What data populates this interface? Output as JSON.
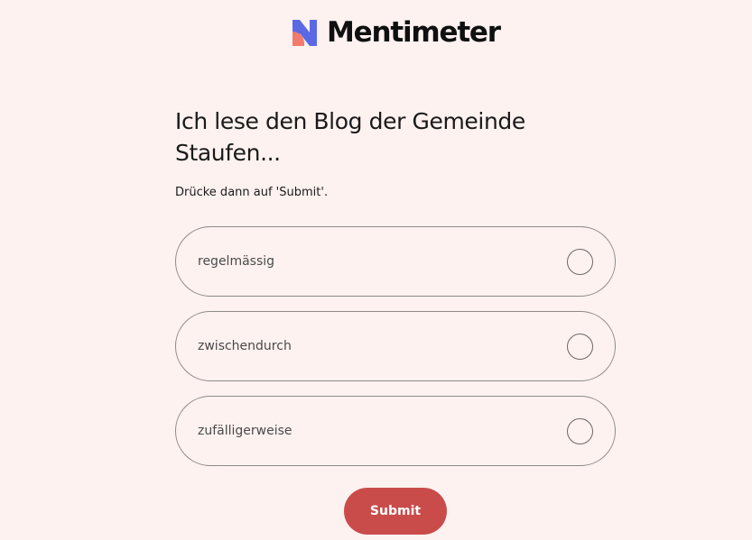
{
  "brand": {
    "name": "Mentimeter",
    "logo_icon": "mentimeter-logo-icon",
    "colors": {
      "blue": "#5b69e4",
      "coral": "#f27b6c"
    }
  },
  "question": {
    "title": "Ich lese den Blog der Gemeinde Staufen...",
    "instruction": "Drücke dann auf 'Submit'."
  },
  "options": [
    {
      "label": "regelmässig",
      "selected": false
    },
    {
      "label": "zwischendurch",
      "selected": false
    },
    {
      "label": "zufälligerweise",
      "selected": false
    }
  ],
  "submit": {
    "label": "Submit",
    "color": "#c94c4b"
  },
  "page": {
    "background": "#fdf2f0"
  }
}
